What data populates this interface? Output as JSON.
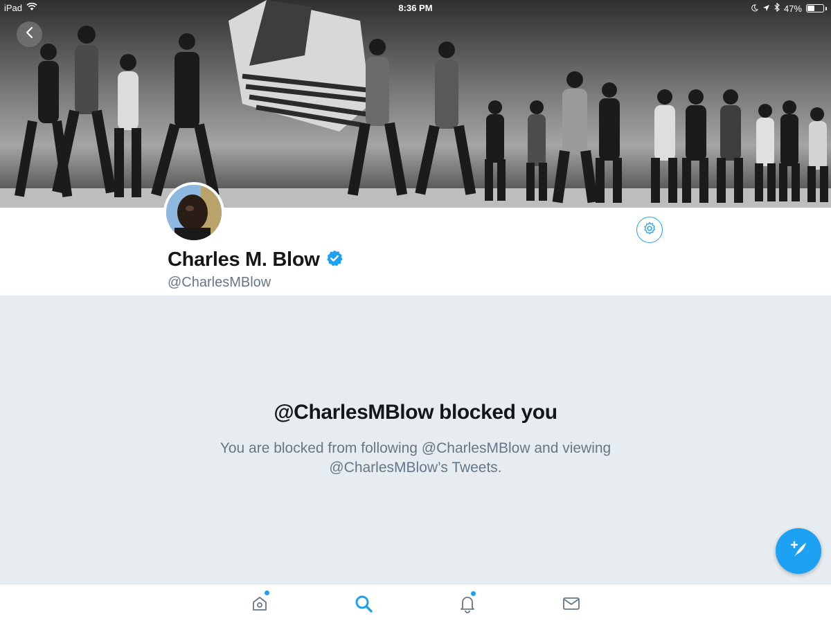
{
  "status_bar": {
    "device": "iPad",
    "time": "8:36 PM",
    "battery": "47%",
    "battery_level": 0.47,
    "icons": [
      "wifi-icon",
      "moon-icon",
      "location-icon",
      "bluetooth-icon",
      "battery-icon"
    ]
  },
  "profile": {
    "display_name": "Charles M. Blow",
    "handle": "@CharlesMBlow",
    "verified": true
  },
  "blocked": {
    "title": "@CharlesMBlow blocked you",
    "message_line1": "You are blocked from following @CharlesMBlow and viewing",
    "message_line2": "@CharlesMBlow’s Tweets."
  },
  "tab_bar": {
    "tabs": [
      {
        "icon": "home-icon",
        "active": false,
        "badge": true
      },
      {
        "icon": "search-icon",
        "active": true,
        "badge": false
      },
      {
        "icon": "notifications-icon",
        "active": false,
        "badge": true
      },
      {
        "icon": "messages-icon",
        "active": false,
        "badge": false
      }
    ]
  },
  "colors": {
    "accent": "#1da1f2",
    "background_gray": "#e6ecf0",
    "secondary_text": "#657786",
    "primary_text": "#14171a"
  }
}
